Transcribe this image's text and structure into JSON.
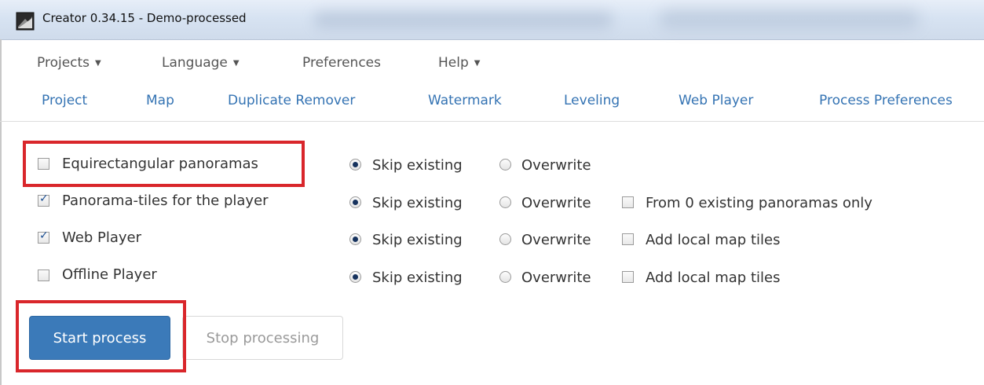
{
  "window": {
    "title": "Creator 0.34.15 - Demo-processed"
  },
  "menu": [
    {
      "label": "Projects",
      "dropdown": true
    },
    {
      "label": "Language",
      "dropdown": true
    },
    {
      "label": "Preferences",
      "dropdown": false
    },
    {
      "label": "Help",
      "dropdown": true
    }
  ],
  "tabs": [
    "Project",
    "Map",
    "Duplicate Remover",
    "Watermark",
    "Leveling",
    "Web Player",
    "Process Preferences"
  ],
  "options": {
    "skip_label": "Skip existing",
    "overwrite_label": "Overwrite",
    "rows": [
      {
        "label": "Equirectangular panoramas",
        "checked": false,
        "mode": "skip",
        "extra": null
      },
      {
        "label": "Panorama-tiles for the player",
        "checked": true,
        "mode": "skip",
        "extra": {
          "label": "From 0 existing panoramas only",
          "checked": false
        }
      },
      {
        "label": "Web Player",
        "checked": true,
        "mode": "skip",
        "extra": {
          "label": "Add local map tiles",
          "checked": false
        }
      },
      {
        "label": "Offline Player",
        "checked": false,
        "mode": "skip",
        "extra": {
          "label": "Add local map tiles",
          "checked": false
        }
      }
    ]
  },
  "buttons": {
    "start": "Start process",
    "stop": "Stop processing"
  },
  "colors": {
    "accent": "#3b7ab9",
    "tab_link": "#3473b3",
    "highlight": "#d9262b"
  }
}
